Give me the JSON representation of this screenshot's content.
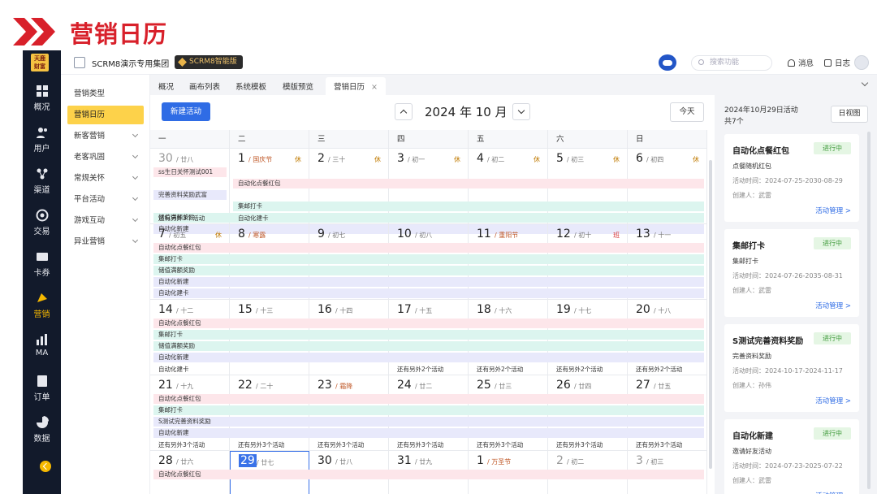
{
  "slide": {
    "title": "营销日历"
  },
  "nav": {
    "logo": "天鹿\n财富",
    "items": [
      {
        "label": "概况",
        "icon": "overview-icon"
      },
      {
        "label": "用户",
        "icon": "users-icon"
      },
      {
        "label": "渠道",
        "icon": "channel-icon"
      },
      {
        "label": "交易",
        "icon": "trade-icon"
      },
      {
        "label": "卡券",
        "icon": "coupon-icon"
      },
      {
        "label": "营销",
        "icon": "marketing-icon",
        "active": true
      },
      {
        "label": "MA",
        "icon": "ma-icon"
      },
      {
        "label": "订单",
        "icon": "order-icon"
      },
      {
        "label": "数据",
        "icon": "data-icon"
      }
    ]
  },
  "topbar": {
    "org_name": "SCRM8演示专用集团",
    "badge": "SCRM8智能版",
    "search_placeholder": "搜索功能",
    "messages": "消息",
    "logs": "日志"
  },
  "submenu": {
    "items": [
      {
        "label": "营销类型",
        "arrow": false
      },
      {
        "label": "营销日历",
        "arrow": false,
        "active": true
      },
      {
        "label": "新客营销",
        "arrow": true
      },
      {
        "label": "老客巩固",
        "arrow": true
      },
      {
        "label": "常规关怀",
        "arrow": true
      },
      {
        "label": "平台活动",
        "arrow": true
      },
      {
        "label": "游戏互动",
        "arrow": true
      },
      {
        "label": "异业营销",
        "arrow": true
      }
    ]
  },
  "tabs": [
    {
      "label": "概况"
    },
    {
      "label": "画布列表"
    },
    {
      "label": "系统模板"
    },
    {
      "label": "模版预览"
    },
    {
      "label": "营销日历",
      "active": true,
      "close": "×"
    }
  ],
  "calendar": {
    "new_button": "新建活动",
    "title": "2024 年 10 月",
    "today_button": "今天",
    "weekdays": [
      "一",
      "二",
      "三",
      "四",
      "五",
      "六",
      "日"
    ],
    "colors": {
      "pink": "#fde6ea",
      "teal": "#dcf5ef",
      "lav": "#e8e9fb",
      "today": "#3a72e8"
    },
    "weeks": [
      {
        "days": [
          {
            "d": "30",
            "l": "廿八",
            "grey": true
          },
          {
            "d": "1",
            "l": "国庆节",
            "hol": true,
            "tag": "休"
          },
          {
            "d": "2",
            "l": "三十",
            "tag": "休"
          },
          {
            "d": "3",
            "l": "初一",
            "tag": "休"
          },
          {
            "d": "4",
            "l": "初二",
            "tag": "休"
          },
          {
            "d": "5",
            "l": "初三",
            "tag": "休"
          },
          {
            "d": "6",
            "l": "初四",
            "tag": "休"
          }
        ],
        "bars": [
          {
            "label": "ss生日关怀测试001",
            "start": 0,
            "end": 0,
            "color": "pink"
          },
          {
            "label": "自动化点餐红包",
            "start": 1,
            "end": 6,
            "color": "pink"
          },
          {
            "label": "完善资料奖励武富",
            "start": 0,
            "end": 0,
            "color": "lav"
          },
          {
            "label": "集邮打卡",
            "start": 1,
            "end": 6,
            "color": "teal"
          },
          {
            "label": "储值满额奖励",
            "start": 0,
            "end": 6,
            "color": "teal"
          },
          {
            "label": "自动化新建",
            "start": 0,
            "end": 6,
            "color": "lav"
          }
        ],
        "mores": [
          {
            "label": "还有另外3个活动",
            "col": 0
          },
          {
            "label": "自动化建卡",
            "col": 1
          }
        ]
      },
      {
        "days": [
          {
            "d": "7",
            "l": "初五",
            "tag": "休"
          },
          {
            "d": "8",
            "l": "寒露",
            "hol": true
          },
          {
            "d": "9",
            "l": "初七"
          },
          {
            "d": "10",
            "l": "初八"
          },
          {
            "d": "11",
            "l": "重阳节",
            "hol": true
          },
          {
            "d": "12",
            "l": "初十",
            "tag": "班",
            "ban": true
          },
          {
            "d": "13",
            "l": "十一"
          }
        ],
        "bars": [
          {
            "label": "自动化点餐红包",
            "start": 0,
            "end": 6,
            "color": "pink"
          },
          {
            "label": "集邮打卡",
            "start": 0,
            "end": 6,
            "color": "teal"
          },
          {
            "label": "储值满额奖励",
            "start": 0,
            "end": 6,
            "color": "teal"
          },
          {
            "label": "自动化新建",
            "start": 0,
            "end": 6,
            "color": "lav"
          },
          {
            "label": "自动化建卡",
            "start": 0,
            "end": 6,
            "color": "lav"
          }
        ],
        "mores": []
      },
      {
        "days": [
          {
            "d": "14",
            "l": "十二"
          },
          {
            "d": "15",
            "l": "十三"
          },
          {
            "d": "16",
            "l": "十四"
          },
          {
            "d": "17",
            "l": "十五"
          },
          {
            "d": "18",
            "l": "十六"
          },
          {
            "d": "19",
            "l": "十七"
          },
          {
            "d": "20",
            "l": "十八"
          }
        ],
        "bars": [
          {
            "label": "自动化点餐红包",
            "start": 0,
            "end": 6,
            "color": "pink"
          },
          {
            "label": "集邮打卡",
            "start": 0,
            "end": 6,
            "color": "teal"
          },
          {
            "label": "储值满额奖励",
            "start": 0,
            "end": 6,
            "color": "teal"
          },
          {
            "label": "自动化新建",
            "start": 0,
            "end": 6,
            "color": "lav"
          }
        ],
        "mores": [
          {
            "label": "自动化建卡",
            "col": 0
          },
          {
            "label": "还有另外2个活动",
            "col": 3
          },
          {
            "label": "还有另外2个活动",
            "col": 4
          },
          {
            "label": "还有另外2个活动",
            "col": 5
          },
          {
            "label": "还有另外2个活动",
            "col": 6
          }
        ]
      },
      {
        "days": [
          {
            "d": "21",
            "l": "十九"
          },
          {
            "d": "22",
            "l": "二十"
          },
          {
            "d": "23",
            "l": "霜降",
            "hol": true
          },
          {
            "d": "24",
            "l": "廿二"
          },
          {
            "d": "25",
            "l": "廿三"
          },
          {
            "d": "26",
            "l": "廿四"
          },
          {
            "d": "27",
            "l": "廿五"
          }
        ],
        "bars": [
          {
            "label": "自动化点餐红包",
            "start": 0,
            "end": 6,
            "color": "pink"
          },
          {
            "label": "集邮打卡",
            "start": 0,
            "end": 6,
            "color": "teal"
          },
          {
            "label": "S测试完善资料奖励",
            "start": 0,
            "end": 6,
            "color": "lav"
          },
          {
            "label": "自动化新建",
            "start": 0,
            "end": 6,
            "color": "lav"
          }
        ],
        "mores": [
          {
            "label": "还有另外3个活动",
            "col": 0
          },
          {
            "label": "还有另外3个活动",
            "col": 1
          },
          {
            "label": "还有另外3个活动",
            "col": 2
          },
          {
            "label": "还有另外3个活动",
            "col": 3
          },
          {
            "label": "还有另外3个活动",
            "col": 4
          },
          {
            "label": "还有另外3个活动",
            "col": 5
          },
          {
            "label": "还有另外3个活动",
            "col": 6
          }
        ]
      },
      {
        "days": [
          {
            "d": "28",
            "l": "廿六"
          },
          {
            "d": "29",
            "l": "廿七",
            "today": true
          },
          {
            "d": "30",
            "l": "廿八"
          },
          {
            "d": "31",
            "l": "廿九"
          },
          {
            "d": "1",
            "l": "万圣节",
            "hol": true
          },
          {
            "d": "2",
            "l": "初二",
            "grey": true
          },
          {
            "d": "3",
            "l": "初三",
            "grey": true
          }
        ],
        "bars": [
          {
            "label": "自动化点餐红包",
            "start": 0,
            "end": 6,
            "color": "pink"
          }
        ],
        "mores": []
      }
    ]
  },
  "side": {
    "date": "2024年10月29日活动",
    "count": "共7个",
    "dayview_button": "日视图",
    "cards": [
      {
        "title": "自动化点餐红包",
        "status": "进行中",
        "desc": "点餐随机红包",
        "time": "活动时间：2024-07-25-2030-08-29",
        "creator": "创建人：武雷",
        "link": "活动管理 >"
      },
      {
        "title": "集邮打卡",
        "status": "进行中",
        "desc": "集邮打卡",
        "time": "活动时间：2024-07-26-2035-08-31",
        "creator": "创建人：武雷",
        "link": "活动管理 >"
      },
      {
        "title": "S测试完善资料奖励",
        "status": "进行中",
        "desc": "完善资料奖励",
        "time": "活动时间：2024-10-17-2024-11-17",
        "creator": "创建人：孙伟",
        "link": "活动管理 >"
      },
      {
        "title": "自动化新建",
        "status": "进行中",
        "desc": "邀请好友活动",
        "time": "活动时间：2024-07-23-2025-07-22",
        "creator": "创建人：武雷",
        "link": "活动管理 >"
      }
    ]
  }
}
